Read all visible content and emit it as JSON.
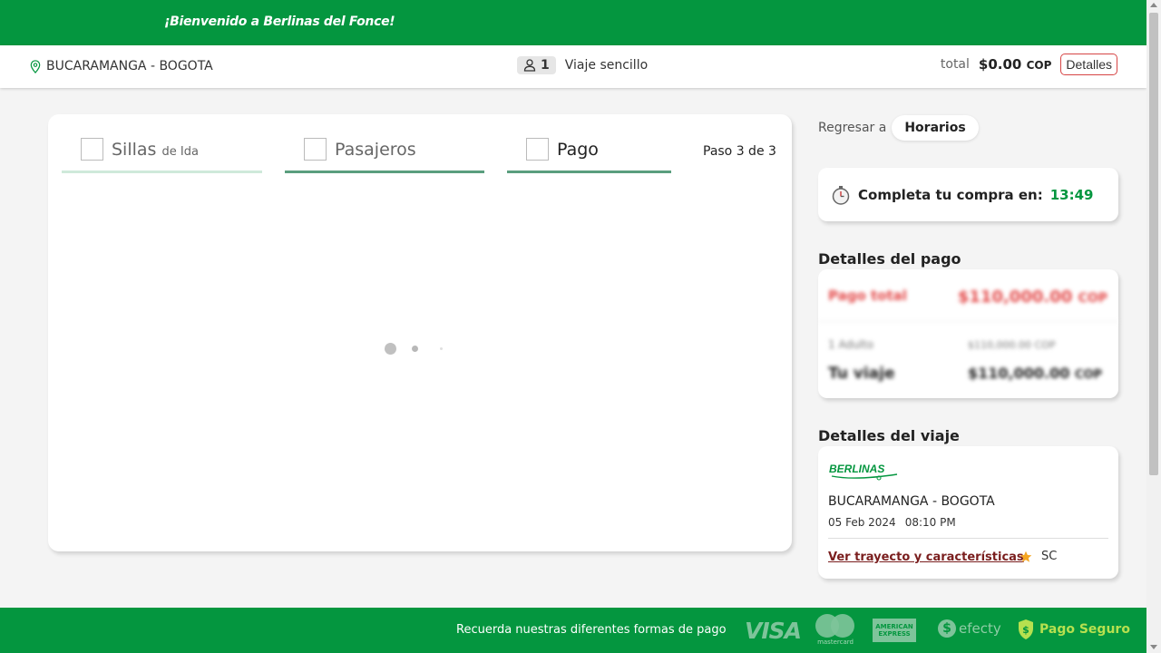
{
  "header": {
    "welcome": "¡Bienvenido a Berlinas del Fonce!"
  },
  "trip_bar": {
    "route": "BUCARAMANGA - BOGOTA",
    "passengers": "1",
    "trip_type": "Viaje sencillo",
    "total_label": "total",
    "total_amount": "$0.00",
    "total_currency": "COP",
    "details_button": "Detalles"
  },
  "steps": {
    "tabs": [
      {
        "label": "Sillas",
        "sub": "de Ida",
        "icon": "seat-image"
      },
      {
        "label": "Pasajeros",
        "sub": "",
        "icon": "passengers-image"
      },
      {
        "label": "Pago",
        "sub": "",
        "icon": "payment-image"
      }
    ],
    "active_tab": "Pago",
    "step_indicator": "Paso 3 de 3"
  },
  "sidebar": {
    "back_label": "Regresar a",
    "back_button": "Horarios",
    "timer_label": "Completa tu compra en:",
    "timer_value": "13:49",
    "payment_title": "Detalles del pago",
    "payment": {
      "total_label": "Pago total",
      "total_value": "$110,000.00",
      "total_currency": "COP",
      "line_label": "1 Adulto",
      "line_value": "$110,000.00 COP",
      "trip_label": "Tu viaje",
      "trip_value": "$110,000.00",
      "trip_currency": "COP"
    },
    "trip_title": "Detalles del viaje",
    "trip": {
      "logo_text": "BERLINAS",
      "route": "BUCARAMANGA - BOGOTA",
      "date": "05 Feb 2024",
      "time": "08:10 PM",
      "link": "Ver trayecto y características",
      "class": "SC"
    }
  },
  "footer": {
    "text": "Recuerda nuestras diferentes formas de pago",
    "methods": {
      "visa": "VISA",
      "mastercard": "mastercard",
      "amex": "AMERICAN EXPRESS",
      "efecty": "efecty"
    },
    "secure": "Pago Seguro"
  },
  "colors": {
    "brand_green": "#04963f",
    "accent_red": "#e34a4a",
    "link_dark_red": "#7a1e1e",
    "secure_lime": "#b6e04f"
  }
}
